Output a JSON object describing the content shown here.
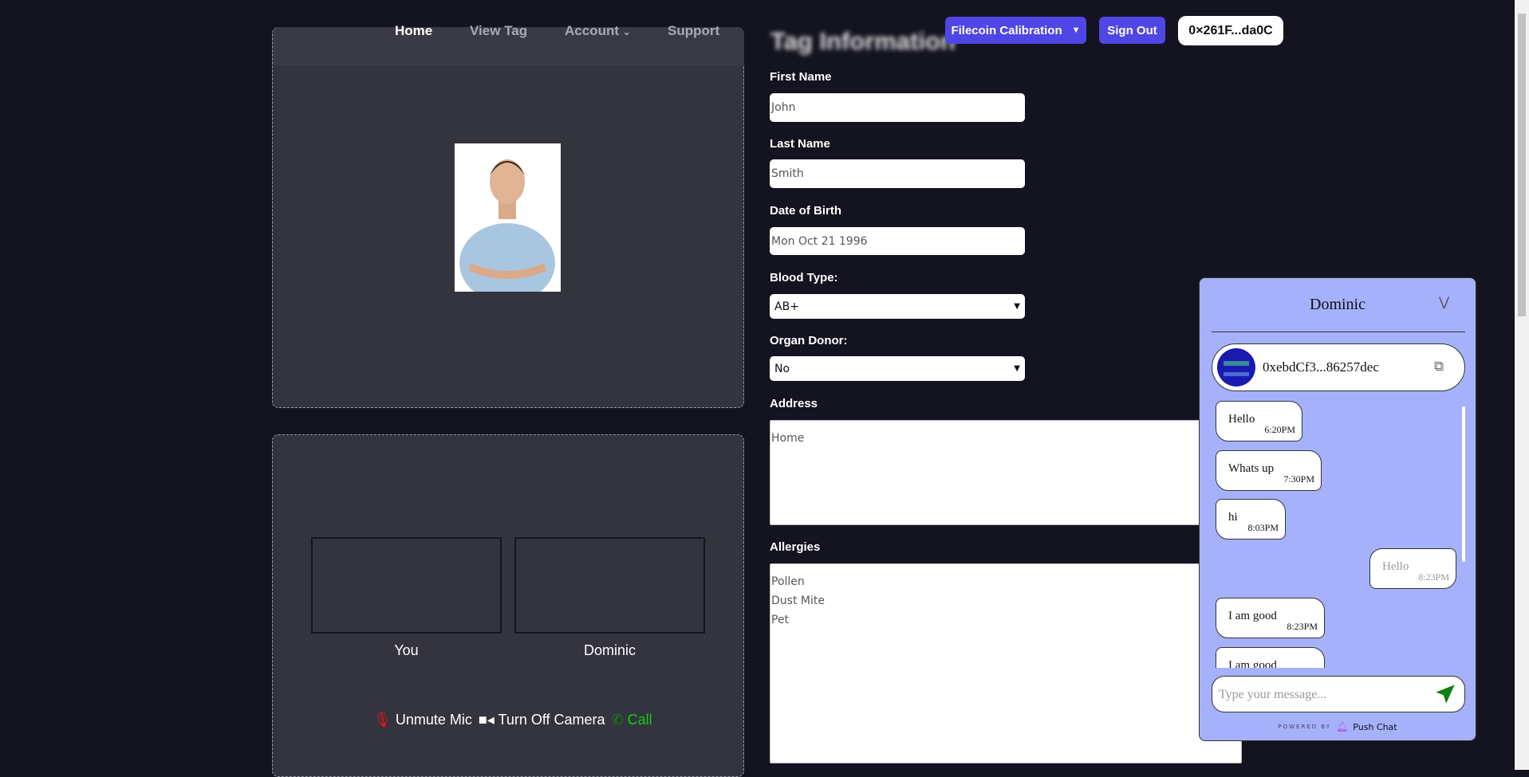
{
  "nav": {
    "items": [
      "Home",
      "View Tag",
      "Account",
      "Support"
    ]
  },
  "header": {
    "network": "Filecoin Calibration",
    "sign_out": "Sign Out",
    "wallet": "0×261F...da0C"
  },
  "tag_title": "Tag Information",
  "form": {
    "first_name_label": "First Name",
    "first_name": "John",
    "last_name_label": "Last Name",
    "last_name": "Smith",
    "dob_label": "Date of Birth",
    "dob": "Mon Oct 21 1996",
    "blood_label": "Blood Type:",
    "blood": "AB+",
    "organ_label": "Organ Donor:",
    "organ": "No",
    "address_label": "Address",
    "address": "Home",
    "allergies_label": "Allergies",
    "allergies": [
      "Pollen",
      "Dust Mite",
      "Pet"
    ]
  },
  "video": {
    "you": "You",
    "peer": "Dominic",
    "mic": "Unmute Mic",
    "camera": "Turn Off Camera",
    "call": "Call"
  },
  "chat": {
    "title": "Dominic",
    "address": "0xebdCf3...86257dec",
    "messages": [
      {
        "text": "Hello",
        "time": "6:20PM",
        "side": "left"
      },
      {
        "text": "Whats up",
        "time": "7:30PM",
        "side": "left"
      },
      {
        "text": "hi",
        "time": "8:03PM",
        "side": "left"
      },
      {
        "text": "Hello",
        "time": "8:23PM",
        "side": "right"
      },
      {
        "text": "I am good",
        "time": "8:23PM",
        "side": "left"
      },
      {
        "text": "I am good",
        "time": "",
        "side": "left"
      }
    ],
    "placeholder": "Type your message...",
    "powered_by": "POWERED BY",
    "brand": "Push Chat"
  },
  "colors": {
    "accent": "#4f46e5",
    "chat_bg": "#a5b1fb",
    "page_bg": "#141420",
    "card_bg": "#34343f",
    "mic_off": "#e11",
    "call": "#1c1"
  }
}
